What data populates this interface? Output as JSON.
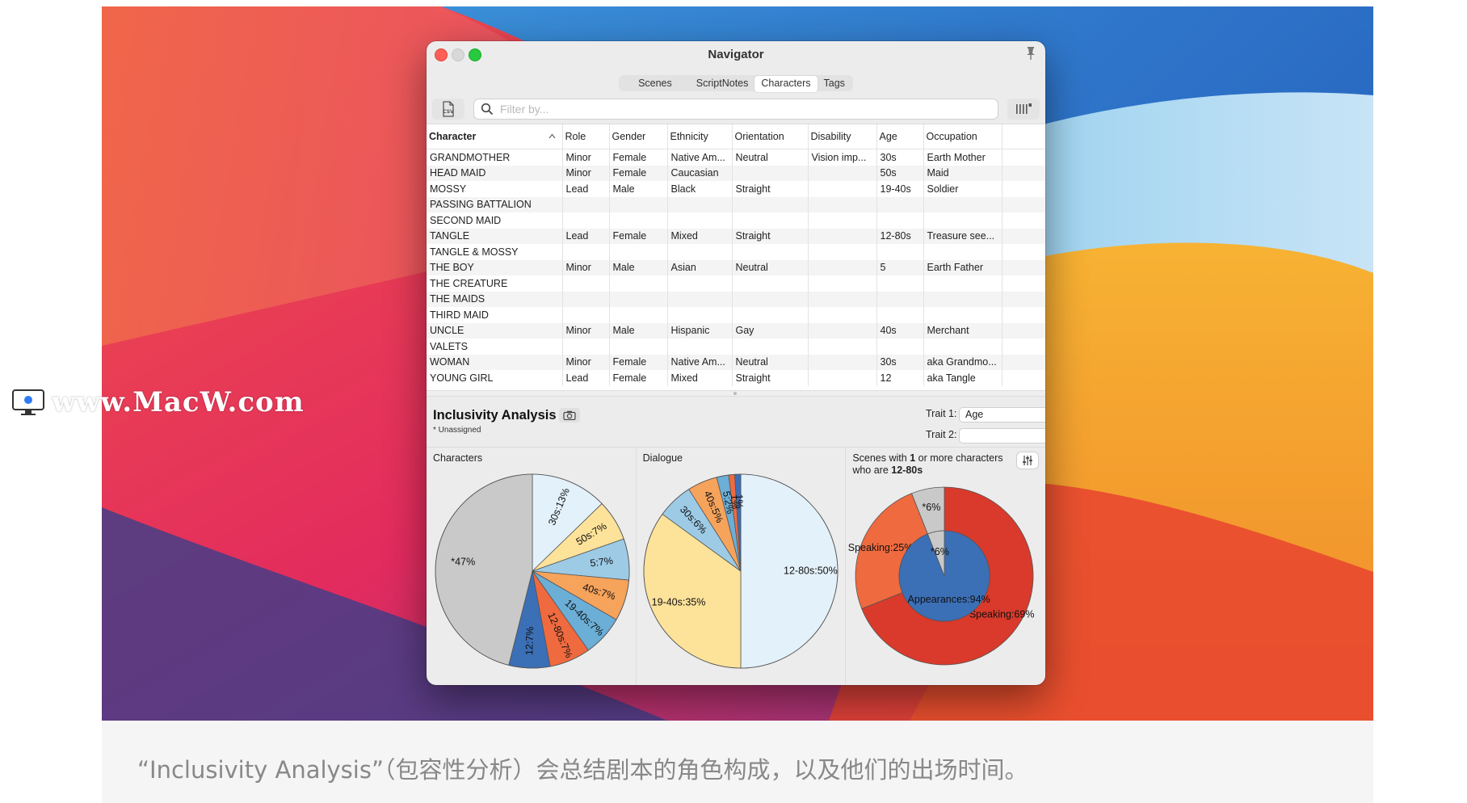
{
  "watermark": {
    "text": "www.MacW.com"
  },
  "window": {
    "title": "Navigator",
    "tabs": [
      {
        "label": "Scenes",
        "selected": false
      },
      {
        "label": "ScriptNotes",
        "selected": false
      },
      {
        "label": "Characters",
        "selected": true
      },
      {
        "label": "Tags",
        "selected": false
      }
    ],
    "search": {
      "placeholder": "Filter by...",
      "value": ""
    },
    "icons": {
      "export": "csv-export-icon",
      "columns": "columns-icon",
      "pin": "pin-icon",
      "search": "search-icon"
    }
  },
  "table": {
    "headers": [
      "Character",
      "Role",
      "Gender",
      "Ethnicity",
      "Orientation",
      "Disability",
      "Age",
      "Occupation"
    ],
    "sorted_column": "Character",
    "rows": [
      [
        "GRANDMOTHER",
        "Minor",
        "Female",
        "Native Am...",
        "Neutral",
        "Vision imp...",
        "30s",
        "Earth Mother"
      ],
      [
        "HEAD MAID",
        "Minor",
        "Female",
        "Caucasian",
        "",
        "",
        "50s",
        "Maid"
      ],
      [
        "MOSSY",
        "Lead",
        "Male",
        "Black",
        "Straight",
        "",
        "19-40s",
        "Soldier"
      ],
      [
        "PASSING BATTALION",
        "",
        "",
        "",
        "",
        "",
        "",
        ""
      ],
      [
        "SECOND MAID",
        "",
        "",
        "",
        "",
        "",
        "",
        ""
      ],
      [
        "TANGLE",
        "Lead",
        "Female",
        "Mixed",
        "Straight",
        "",
        "12-80s",
        "Treasure see..."
      ],
      [
        "TANGLE & MOSSY",
        "",
        "",
        "",
        "",
        "",
        "",
        ""
      ],
      [
        "THE BOY",
        "Minor",
        "Male",
        "Asian",
        "Neutral",
        "",
        "5",
        "Earth Father"
      ],
      [
        "THE CREATURE",
        "",
        "",
        "",
        "",
        "",
        "",
        ""
      ],
      [
        "THE MAIDS",
        "",
        "",
        "",
        "",
        "",
        "",
        ""
      ],
      [
        "THIRD MAID",
        "",
        "",
        "",
        "",
        "",
        "",
        ""
      ],
      [
        "UNCLE",
        "Minor",
        "Male",
        "Hispanic",
        "Gay",
        "",
        "40s",
        "Merchant"
      ],
      [
        "VALETS",
        "",
        "",
        "",
        "",
        "",
        "",
        ""
      ],
      [
        "WOMAN",
        "Minor",
        "Female",
        "Native Am...",
        "Neutral",
        "",
        "30s",
        "aka Grandmo..."
      ],
      [
        "YOUNG GIRL",
        "Lead",
        "Female",
        "Mixed",
        "Straight",
        "",
        "12",
        "aka Tangle"
      ]
    ]
  },
  "analysis": {
    "title": "Inclusivity Analysis",
    "note": "* Unassigned",
    "trait1_label": "Trait 1:",
    "trait1_value": "Age",
    "trait2_label": "Trait 2:",
    "trait2_value": "",
    "panels": {
      "characters": "Characters",
      "dialogue": "Dialogue",
      "scenes_prefix": "Scenes with ",
      "scenes_count": "1",
      "scenes_mid": " or more characters",
      "scenes_line2": "who are ",
      "scenes_trait": "12-80s"
    }
  },
  "chart_data": [
    {
      "type": "pie",
      "title": "Characters",
      "slices": [
        {
          "label": "30s:13%",
          "value": 13,
          "color": "#e3f1fa"
        },
        {
          "label": "50s:7%",
          "value": 7,
          "color": "#fde29a"
        },
        {
          "label": "5:7%",
          "value": 7,
          "color": "#9dcbe6"
        },
        {
          "label": "40s:7%",
          "value": 7,
          "color": "#f6a35b"
        },
        {
          "label": "19-40s:7%",
          "value": 7,
          "color": "#6baed6"
        },
        {
          "label": "12-80s:7%",
          "value": 7,
          "color": "#ef6a3f"
        },
        {
          "label": "12:7%",
          "value": 7,
          "color": "#3b6fb6"
        },
        {
          "label": "*47%",
          "value": 47,
          "color": "#c9c9c9"
        }
      ]
    },
    {
      "type": "pie",
      "title": "Dialogue",
      "slices": [
        {
          "label": "12-80s:50%",
          "value": 50,
          "color": "#e3f1fa"
        },
        {
          "label": "19-40s:35%",
          "value": 35,
          "color": "#fde29a"
        },
        {
          "label": "30s:6%",
          "value": 6,
          "color": "#9dcbe6"
        },
        {
          "label": "40s:5%",
          "value": 5,
          "color": "#f6a35b"
        },
        {
          "label": "5:2%",
          "value": 2,
          "color": "#6baed6"
        },
        {
          "label": "1%",
          "value": 1,
          "color": "#ef6a3f"
        },
        {
          "label": "1%",
          "value": 1,
          "color": "#3b6fb6"
        }
      ]
    },
    {
      "type": "pie",
      "subtype": "nested-donut",
      "title": "Scenes with 1 or more characters who are 12-80s",
      "outer": [
        {
          "label": "Speaking:69%",
          "value": 69,
          "color": "#d93a2b"
        },
        {
          "label": "Speaking:25%",
          "value": 25,
          "color": "#ef6a3f"
        },
        {
          "label": "*6%",
          "value": 6,
          "color": "#c9c9c9"
        }
      ],
      "inner": [
        {
          "label": "Appearances:94%",
          "value": 94,
          "color": "#3b6fb6"
        },
        {
          "label": "*6%",
          "value": 6,
          "color": "#c9c9c9"
        }
      ]
    }
  ],
  "caption": "“Inclusivity Analysis”（包容性分析）会总结剧本的角色构成，以及他们的出场时间。"
}
